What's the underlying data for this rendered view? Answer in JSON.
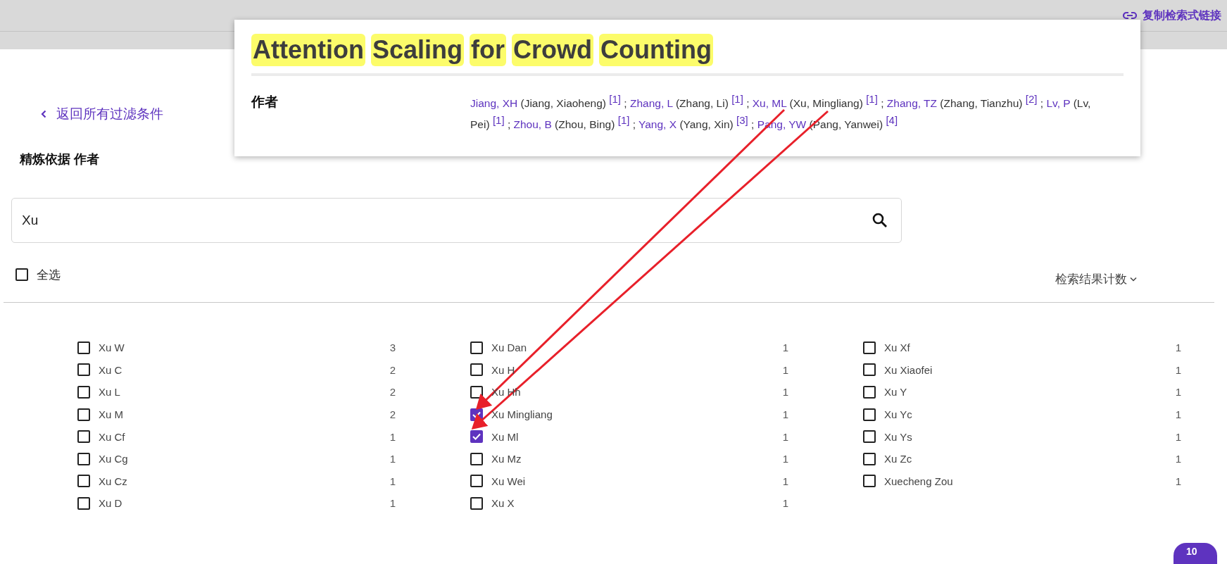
{
  "header": {
    "copy_link": "复制检索式链接"
  },
  "back_link": "返回所有过滤条件",
  "heading": "精炼依据 作者",
  "search": {
    "value": "Xu"
  },
  "select_all": {
    "label": "全选",
    "checked": false
  },
  "sort": {
    "label": "检索结果计数"
  },
  "columns": [
    {
      "items": [
        {
          "name": "Xu W",
          "count": "3",
          "checked": false
        },
        {
          "name": "Xu C",
          "count": "2",
          "checked": false
        },
        {
          "name": "Xu L",
          "count": "2",
          "checked": false
        },
        {
          "name": "Xu M",
          "count": "2",
          "checked": false
        },
        {
          "name": "Xu Cf",
          "count": "1",
          "checked": false
        },
        {
          "name": "Xu Cg",
          "count": "1",
          "checked": false
        },
        {
          "name": "Xu Cz",
          "count": "1",
          "checked": false
        },
        {
          "name": "Xu D",
          "count": "1",
          "checked": false
        }
      ]
    },
    {
      "items": [
        {
          "name": "Xu Dan",
          "count": "1",
          "checked": false
        },
        {
          "name": "Xu H",
          "count": "1",
          "checked": false
        },
        {
          "name": "Xu Hh",
          "count": "1",
          "checked": false
        },
        {
          "name": "Xu Mingliang",
          "count": "1",
          "checked": true
        },
        {
          "name": "Xu Ml",
          "count": "1",
          "checked": true
        },
        {
          "name": "Xu Mz",
          "count": "1",
          "checked": false
        },
        {
          "name": "Xu Wei",
          "count": "1",
          "checked": false
        },
        {
          "name": "Xu X",
          "count": "1",
          "checked": false
        }
      ]
    },
    {
      "items": [
        {
          "name": "Xu Xf",
          "count": "1",
          "checked": false
        },
        {
          "name": "Xu Xiaofei",
          "count": "1",
          "checked": false
        },
        {
          "name": "Xu Y",
          "count": "1",
          "checked": false
        },
        {
          "name": "Xu Yc",
          "count": "1",
          "checked": false
        },
        {
          "name": "Xu Ys",
          "count": "1",
          "checked": false
        },
        {
          "name": "Xu Zc",
          "count": "1",
          "checked": false
        },
        {
          "name": "Xuecheng Zou",
          "count": "1",
          "checked": false
        }
      ]
    }
  ],
  "popup": {
    "title_words": [
      {
        "text": "Attention",
        "highlighted": true
      },
      {
        "text": "Scaling",
        "highlighted": true
      },
      {
        "text": "for",
        "highlighted": true
      },
      {
        "text": "Crowd",
        "highlighted": true
      },
      {
        "text": "Counting",
        "highlighted": true
      }
    ],
    "authors_label": "作者",
    "authors": [
      {
        "short": "Jiang, XH",
        "full": "(Jiang, Xiaoheng)",
        "ref": "[1]",
        "separator": ";"
      },
      {
        "short": "Zhang, L",
        "full": "(Zhang, Li)",
        "ref": "[1]",
        "separator": ";"
      },
      {
        "short": "Xu, ML",
        "full": "(Xu, Mingliang)",
        "ref": "[1]",
        "separator": ";"
      },
      {
        "short": "Zhang, TZ",
        "full": "(Zhang, Tianzhu)",
        "ref": "[2]",
        "separator": ";"
      },
      {
        "short": "Lv, P",
        "full": "(Lv, Pei)",
        "ref": "[1]",
        "separator": ";"
      },
      {
        "short": "Zhou, B",
        "full": "(Zhou, Bing)",
        "ref": "[1]",
        "separator": ";"
      },
      {
        "short": "Yang, X",
        "full": "(Yang, Xin)",
        "ref": "[3]",
        "separator": ";"
      },
      {
        "short": "Pang, YW",
        "full": "(Pang, Yanwei)",
        "ref": "[4]"
      }
    ]
  },
  "chat_badge": {
    "count": "10"
  }
}
